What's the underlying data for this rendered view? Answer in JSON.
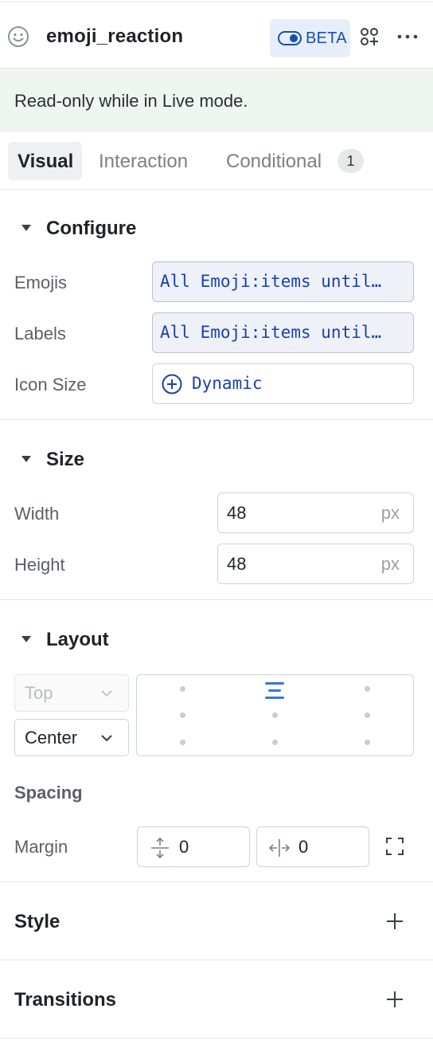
{
  "header": {
    "title": "emoji_reaction",
    "badge": "BETA",
    "icons": [
      "emoji-face-icon",
      "toggle-icon",
      "apps-icon",
      "more-icon"
    ]
  },
  "banner": {
    "text": "Read-only while in Live mode."
  },
  "tabs": [
    {
      "label": "Visual",
      "active": true
    },
    {
      "label": "Interaction"
    },
    {
      "label": "Conditional",
      "badge": "1"
    }
  ],
  "configure": {
    "title": "Configure",
    "emojis": {
      "label": "Emojis",
      "value": "All Emoji:items until…"
    },
    "labels": {
      "label": "Labels",
      "value": "All Emoji:items until…"
    },
    "icon_size": {
      "label": "Icon Size",
      "value": "Dynamic"
    }
  },
  "size": {
    "title": "Size",
    "width": {
      "label": "Width",
      "value": "48",
      "unit": "px"
    },
    "height": {
      "label": "Height",
      "value": "48",
      "unit": "px"
    }
  },
  "layout": {
    "title": "Layout",
    "vertical_align": "Top",
    "horizontal_align": "Center",
    "active_cell": "top-center",
    "spacing_label": "Spacing",
    "margin_label": "Margin",
    "margin_vertical": "0",
    "margin_horizontal": "0"
  },
  "style": {
    "title": "Style"
  },
  "transitions": {
    "title": "Transitions"
  },
  "colors": {
    "accent": "#1a4db3",
    "banner_bg": "#eff6ef",
    "badge_bg": "#e8eef9",
    "active_align": "#3b73e0"
  }
}
